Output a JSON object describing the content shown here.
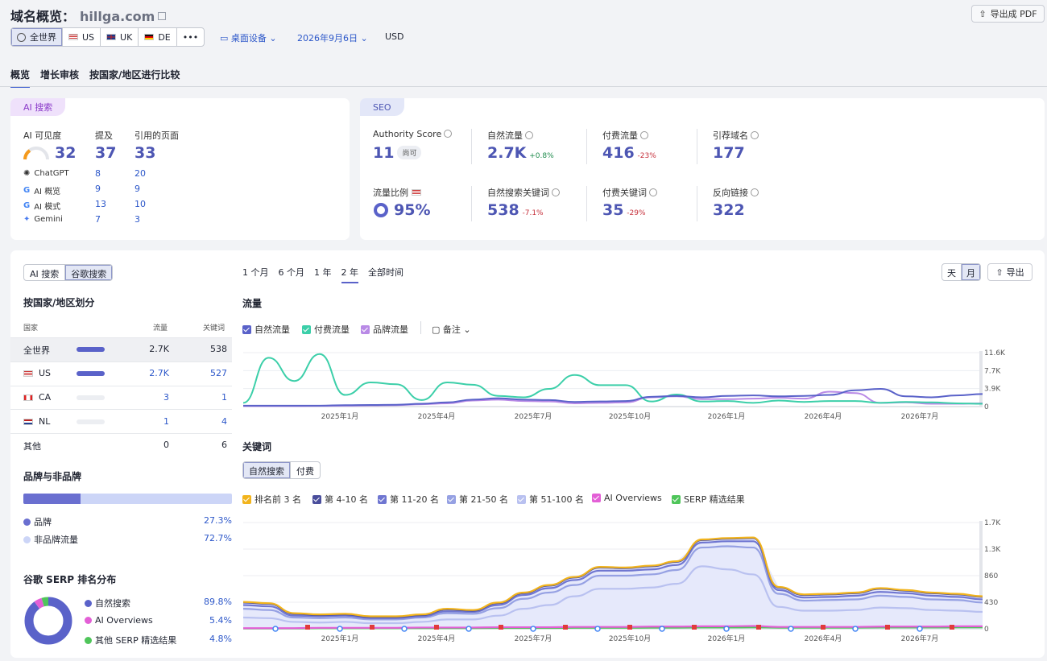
{
  "header": {
    "title": "域名概览：",
    "domain": "hillga.com",
    "export_pdf": "导出成 PDF",
    "regions": [
      "全世界",
      "US",
      "UK",
      "DE"
    ],
    "more": "•••",
    "device": "桌面设备",
    "date": "2026年9月6日",
    "currency": "USD"
  },
  "tabs": [
    "概览",
    "增长审核",
    "按国家/地区进行比较"
  ],
  "ai_card": {
    "tag": "AI 搜索",
    "col_visibility": "AI 可见度",
    "col_mentions": "提及",
    "col_cited": "引用的页面",
    "visibility": "32",
    "mentions": "37",
    "cited": "33",
    "rows": [
      {
        "name": "ChatGPT",
        "icon": "chatgpt-icon",
        "mentions": "8",
        "cited": "20"
      },
      {
        "name": "AI 概览",
        "icon": "google-icon",
        "mentions": "9",
        "cited": "9"
      },
      {
        "name": "AI 模式",
        "icon": "google-icon",
        "mentions": "13",
        "cited": "10"
      },
      {
        "name": "Gemini",
        "icon": "gemini-icon",
        "mentions": "7",
        "cited": "3"
      }
    ]
  },
  "seo_card": {
    "tag": "SEO",
    "authority_label": "Authority Score",
    "authority": "11",
    "authority_badge": "尚可",
    "organic_label": "自然流量",
    "organic": "2.7K",
    "organic_change": "+0.8%",
    "paid_label": "付费流量",
    "paid": "416",
    "paid_change": "-23%",
    "ref_label": "引荐域名",
    "ref": "177",
    "share_label": "流量比例",
    "share": "95%",
    "org_kw_label": "自然搜索关键词",
    "org_kw": "538",
    "org_kw_change": "-7.1%",
    "paid_kw_label": "付费关键词",
    "paid_kw": "35",
    "paid_kw_change": "-29%",
    "backlinks_label": "反向链接",
    "backlinks": "322"
  },
  "left": {
    "toggle": [
      "AI 搜索",
      "谷歌搜索"
    ],
    "country_title": "按国家/地区划分",
    "col_country": "国家",
    "col_traffic": "流量",
    "col_keywords": "关键词",
    "rows": [
      {
        "name": "全世界",
        "traffic": "2.7K",
        "keywords": "538",
        "share": 1.0
      },
      {
        "name": "US",
        "traffic": "2.7K",
        "keywords": "527",
        "share": 1.0
      },
      {
        "name": "CA",
        "traffic": "3",
        "keywords": "1",
        "share": 0
      },
      {
        "name": "NL",
        "traffic": "1",
        "keywords": "4",
        "share": 0
      },
      {
        "name": "其他",
        "traffic": "0",
        "keywords": "6",
        "share": 0
      }
    ],
    "brand_title": "品牌与非品牌",
    "brand_label": "品牌",
    "brand_pct": "27.3%",
    "brand_value": 27.3,
    "nonbrand_label": "非品牌流量",
    "nonbrand_pct": "72.7%",
    "serp_title": "谷歌 SERP 排名分布",
    "serp": [
      {
        "label": "自然搜索",
        "pct": "89.8%",
        "value": 89.8,
        "color": "#5a62c9"
      },
      {
        "label": "AI Overviews",
        "pct": "5.4%",
        "value": 5.4,
        "color": "#e35fd6"
      },
      {
        "label": "其他 SERP 精选结果",
        "pct": "4.8%",
        "value": 4.8,
        "color": "#4fc55a"
      }
    ]
  },
  "ranges": [
    "1 个月",
    "6 个月",
    "1 年",
    "2 年",
    "全部时间"
  ],
  "granularity": [
    "天",
    "月"
  ],
  "export": "导出",
  "traffic": {
    "title": "流量",
    "legend": [
      {
        "label": "自然流量",
        "color": "#5a62c9"
      },
      {
        "label": "付费流量",
        "color": "#3ccfa9"
      },
      {
        "label": "品牌流量",
        "color": "#b98ae6"
      }
    ],
    "notes": "备注"
  },
  "keywords": {
    "title": "关键词",
    "toggle": [
      "自然搜索",
      "付费"
    ],
    "legend": [
      {
        "label": "排名前 3 名",
        "color": "#f2b41c"
      },
      {
        "label": "第 4-10 名",
        "color": "#4a4e9c"
      },
      {
        "label": "第 11-20 名",
        "color": "#6f76d1"
      },
      {
        "label": "第 21-50 名",
        "color": "#96a1e3"
      },
      {
        "label": "第 51-100 名",
        "color": "#b9c1f0"
      },
      {
        "label": "AI Overviews",
        "color": "#e35fd6"
      },
      {
        "label": "SERP 精选结果",
        "color": "#4fc55a"
      }
    ]
  },
  "chart_data": [
    {
      "type": "line",
      "title": "流量",
      "x_labels": [
        "2025年1月",
        "2025年4月",
        "2025年7月",
        "2025年10月",
        "2026年1月",
        "2026年4月",
        "2026年7月"
      ],
      "y_ticks": [
        "11.6K",
        "7.7K",
        "3.9K",
        "0"
      ],
      "ylim": [
        0,
        11600
      ],
      "series": [
        {
          "name": "自然流量",
          "color": "#5a62c9",
          "values": [
            200,
            200,
            200,
            200,
            300,
            350,
            400,
            600,
            900,
            1500,
            1800,
            1500,
            1400,
            1000,
            1100,
            1200,
            2100,
            2300,
            2000,
            2300,
            2400,
            2200,
            2300,
            2500,
            3500,
            3800,
            2200,
            2000,
            2400,
            2700
          ]
        },
        {
          "name": "付费流量",
          "color": "#3ccfa9",
          "values": [
            800,
            10500,
            5500,
            11300,
            2500,
            5200,
            4800,
            1400,
            5200,
            4700,
            2300,
            2000,
            3800,
            6800,
            4600,
            4600,
            1100,
            2600,
            1100,
            1200,
            800,
            1300,
            1000,
            1200,
            1200,
            800,
            1000,
            900,
            700,
            600
          ]
        },
        {
          "name": "品牌流量",
          "color": "#b98ae6",
          "values": [
            100,
            100,
            100,
            150,
            200,
            250,
            300,
            500,
            700,
            1300,
            1500,
            1200,
            1100,
            700,
            800,
            900,
            2000,
            2200,
            1600,
            1600,
            1700,
            1900,
            1700,
            3200,
            2900,
            800,
            900,
            600,
            600,
            700
          ]
        }
      ]
    },
    {
      "type": "area",
      "title": "关键词",
      "x_labels": [
        "2025年1月",
        "2025年4月",
        "2025年7月",
        "2025年10月",
        "2026年1月",
        "2026年4月",
        "2026年7月"
      ],
      "y_ticks": [
        "1.7K",
        "1.3K",
        "860",
        "430",
        "0"
      ],
      "ylim": [
        0,
        1700
      ],
      "series": [
        {
          "name": "排名前 3 名",
          "color": "#f2b41c",
          "values": [
            430,
            410,
            250,
            230,
            240,
            200,
            200,
            230,
            320,
            300,
            420,
            580,
            700,
            830,
            990,
            980,
            1010,
            1080,
            1430,
            1450,
            1460,
            670,
            550,
            560,
            580,
            650,
            620,
            580,
            560,
            520
          ]
        },
        {
          "name": "第 4-10 名",
          "color": "#4a4e9c",
          "values": [
            420,
            400,
            240,
            220,
            230,
            190,
            190,
            220,
            310,
            290,
            410,
            570,
            690,
            820,
            980,
            970,
            1000,
            1070,
            1420,
            1440,
            1450,
            660,
            540,
            550,
            570,
            640,
            610,
            570,
            550,
            510
          ]
        },
        {
          "name": "第 11-20 名",
          "color": "#6f76d1",
          "values": [
            380,
            360,
            210,
            200,
            210,
            170,
            170,
            200,
            280,
            270,
            380,
            540,
            650,
            780,
            930,
            930,
            950,
            1020,
            1380,
            1400,
            1400,
            620,
            500,
            510,
            530,
            590,
            570,
            530,
            510,
            470
          ]
        },
        {
          "name": "第 21-50 名",
          "color": "#96a1e3",
          "values": [
            320,
            300,
            180,
            170,
            180,
            150,
            150,
            180,
            250,
            240,
            330,
            480,
            580,
            700,
            850,
            850,
            870,
            940,
            1300,
            1320,
            1300,
            560,
            450,
            460,
            470,
            530,
            510,
            470,
            460,
            420
          ]
        },
        {
          "name": "第 51-100 名",
          "color": "#b9c1f0",
          "values": [
            180,
            170,
            110,
            100,
            110,
            90,
            90,
            110,
            150,
            150,
            210,
            320,
            380,
            520,
            640,
            640,
            660,
            720,
            1000,
            950,
            870,
            350,
            290,
            290,
            300,
            340,
            330,
            300,
            290,
            270
          ]
        },
        {
          "name": "AI Overviews",
          "color": "#e35fd6",
          "values": [
            10,
            10,
            10,
            15,
            15,
            15,
            15,
            20,
            20,
            20,
            25,
            25,
            25,
            30,
            30,
            30,
            35,
            35,
            40,
            40,
            45,
            30,
            30,
            30,
            30,
            35,
            35,
            35,
            40,
            40
          ]
        },
        {
          "name": "SERP 精选结果",
          "color": "#4fc55a",
          "values": [
            5,
            5,
            5,
            8,
            8,
            8,
            8,
            10,
            10,
            10,
            12,
            12,
            12,
            15,
            15,
            15,
            18,
            18,
            20,
            20,
            22,
            18,
            18,
            18,
            18,
            20,
            20,
            20,
            22,
            22
          ]
        }
      ]
    }
  ]
}
